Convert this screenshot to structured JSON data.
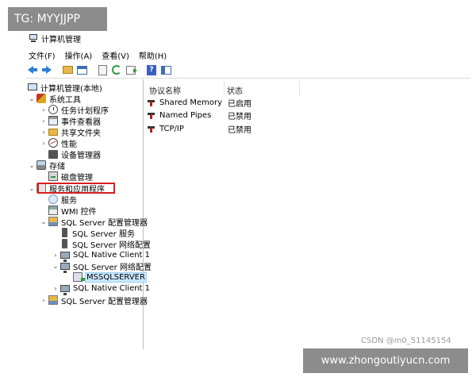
{
  "overlay": {
    "tg_watermark": "TG: MYYJJPP",
    "csdn_credit": "CSDN @m0_51145154",
    "site_watermark": "www.zhongoutiyucn.com"
  },
  "window": {
    "title": "计算机管理"
  },
  "menu": [
    "文件(F)",
    "操作(A)",
    "查看(V)",
    "帮助(H)"
  ],
  "toolbar": {
    "icons": [
      "back-arrow-icon",
      "forward-arrow-icon",
      "folder-up-icon",
      "show-hide-tree-icon",
      "properties-icon",
      "refresh-icon",
      "export-list-icon",
      "help-icon",
      "show-action-pane-icon"
    ]
  },
  "tree": {
    "root": "计算机管理(本地)",
    "system_tools": "系统工具",
    "task_scheduler": "任务计划程序",
    "event_viewer": "事件查看器",
    "shared_folders": "共享文件夹",
    "performance": "性能",
    "device_manager": "设备管理器",
    "storage": "存储",
    "disk_management": "磁盘管理",
    "services_apps": "服务和应用程序",
    "services": "服务",
    "wmi": "WMI 控件",
    "sql_cm": "SQL Server 配置管理器",
    "sql_services": "SQL Server 服务",
    "sql_network_32": "SQL Server 网络配置",
    "native_client_32": "SQL Native Client 1",
    "sql_network": "SQL Server 网络配置",
    "mssqlserver": "MSSQLSERVER",
    "native_client": "SQL Native Client 1",
    "sql_cm_2": "SQL Server 配置管理器"
  },
  "list": {
    "columns": {
      "name": "协议名称",
      "status": "状态"
    },
    "rows": [
      {
        "name": "Shared Memory",
        "status": "已启用"
      },
      {
        "name": "Named Pipes",
        "status": "已禁用"
      },
      {
        "name": "TCP/IP",
        "status": "已禁用"
      }
    ]
  },
  "colors": {
    "highlight_box": "#d61f1f",
    "selection": "#cce8ff"
  }
}
